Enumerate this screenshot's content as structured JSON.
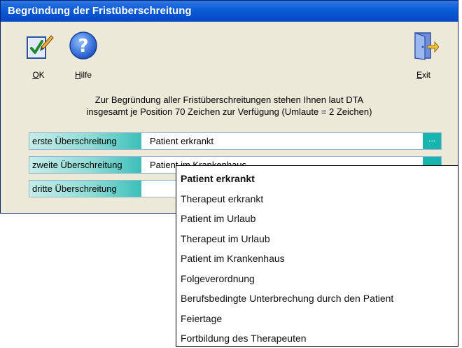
{
  "window": {
    "title": "Begründung der Fristüberschreitung"
  },
  "toolbar": {
    "ok": {
      "underlined": "O",
      "rest": "K",
      "icon": "edit-check-icon"
    },
    "help": {
      "underlined": "H",
      "rest": "ilfe",
      "icon": "help-icon"
    },
    "exit": {
      "underlined": "E",
      "rest": "xit",
      "icon": "exit-door-icon"
    }
  },
  "info": {
    "line1": "Zur Begründung aller Fristüberschreitungen stehen Ihnen laut DTA",
    "line2": "insgesamt je Position 70 Zeichen zur Verfügung (Umlaute = 2 Zeichen)"
  },
  "rows": [
    {
      "label": "erste Überschreitung",
      "value": "Patient erkrankt",
      "button": "..."
    },
    {
      "label": "zweite Überschreitung",
      "value": "Patient im Krankenhaus"
    },
    {
      "label": "dritte Überschreitung",
      "value": ""
    }
  ],
  "dropdown": {
    "selected_index": 0,
    "items": [
      "Patient erkrankt",
      "Therapeut erkrankt",
      "Patient im Urlaub",
      "Therapeut im Urlaub",
      "Patient im Krankenhaus",
      "Folgeverordnung",
      "Berufsbedingte Unterbrechung durch den Patient",
      "Feiertage",
      "Fortbildung des Therapeuten"
    ]
  },
  "colors": {
    "title_bar": "#0a5bd6",
    "accent_teal": "#17b5b0",
    "dialog_bg": "#ece9d8"
  }
}
